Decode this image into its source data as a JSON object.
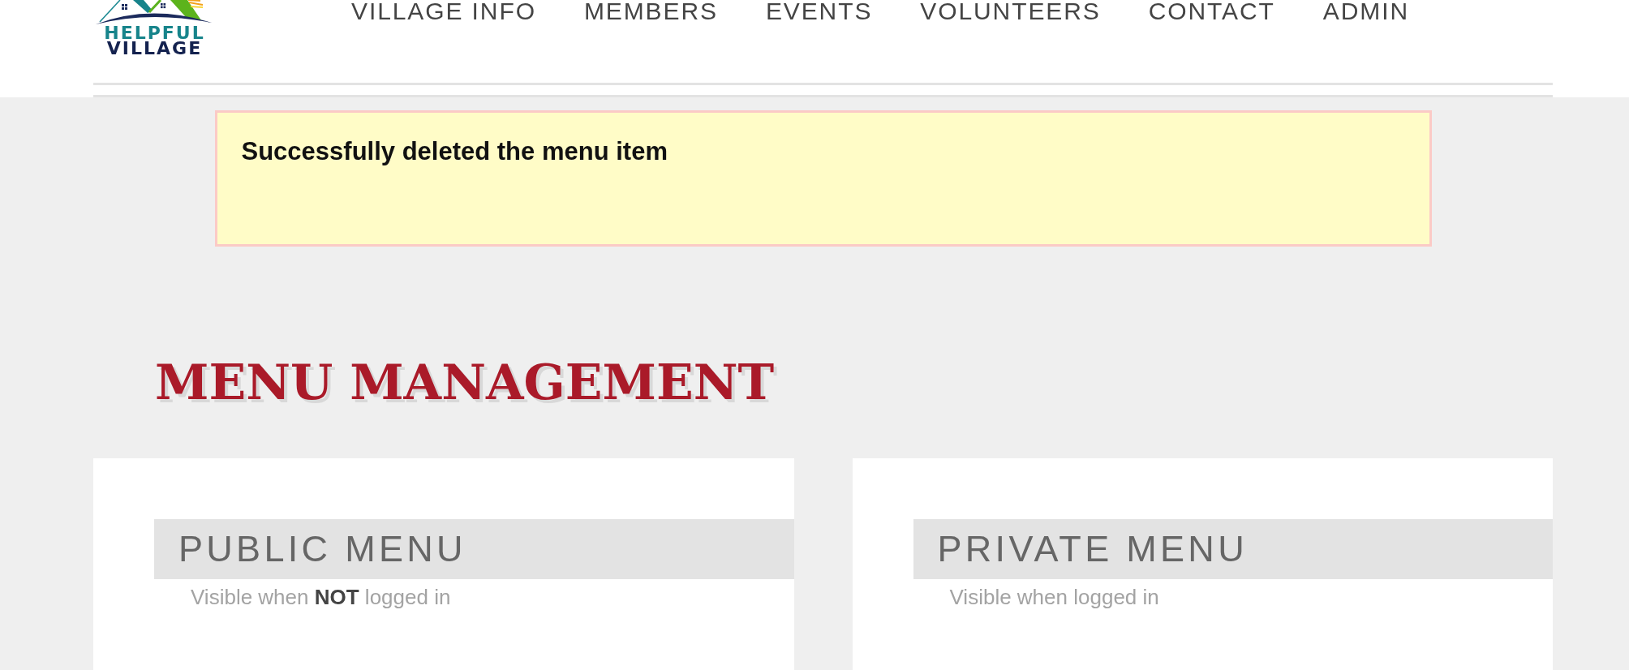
{
  "logo": {
    "lines": [
      "HELPFUL",
      "VILLAGE"
    ]
  },
  "nav": [
    "VILLAGE INFO",
    "MEMBERS",
    "EVENTS",
    "VOLUNTEERS",
    "CONTACT",
    "ADMIN"
  ],
  "alert": {
    "message": "Successfully deleted the menu item"
  },
  "page_title": "MENU MANAGEMENT",
  "panels": [
    {
      "title": "PUBLIC MENU",
      "note": "Visible when **NOT** logged in"
    },
    {
      "title": "PRIVATE MENU",
      "note": "Visible when logged in"
    }
  ]
}
